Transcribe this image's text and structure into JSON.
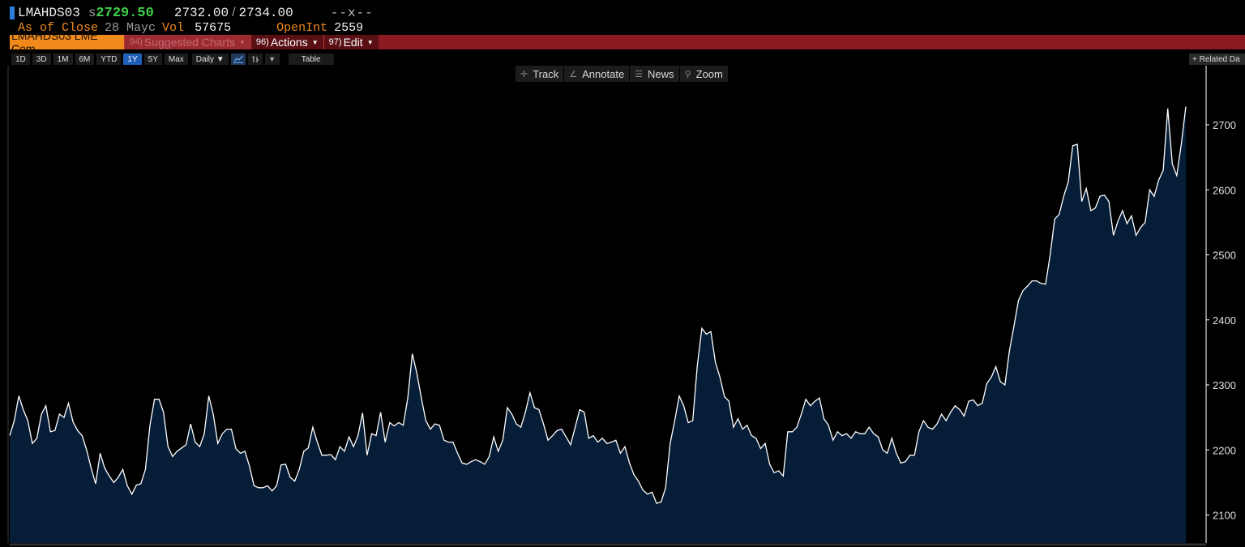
{
  "header": {
    "ticker": "LMAHDS03",
    "last_prefix": "s",
    "last_price": "2729.50",
    "bid": "2732.00",
    "slash": "/",
    "ask": "2734.00",
    "change": "--x--",
    "close_label": "As of Close",
    "close_date": "28 Mayc",
    "vol_label": "Vol",
    "vol_value": "57675",
    "openint_label": "OpenInt",
    "openint_value": "2559"
  },
  "menu": {
    "security": "LMAHDS03 LME Com",
    "suggested_num": "94)",
    "suggested": "Suggested Charts",
    "actions_num": "96)",
    "actions": "Actions",
    "edit_num": "97)",
    "edit": "Edit"
  },
  "ranges": [
    "1D",
    "3D",
    "1M",
    "6M",
    "YTD",
    "1Y",
    "5Y",
    "Max"
  ],
  "active_range": "1Y",
  "frequency": "Daily ▼",
  "table_label": "Table",
  "related_label": "+ Related Da",
  "chart_tools": {
    "track": "Track",
    "annotate": "Annotate",
    "news": "News",
    "zoom": "Zoom"
  },
  "colors": {
    "price_up": "#3fd04a",
    "accent_orange": "#f08a1c",
    "toolbar_red": "#8b1a22",
    "area_fill": "#061d38",
    "line": "#ffffff"
  },
  "chart_data": {
    "type": "area",
    "title": "",
    "xlabel": "",
    "ylabel": "",
    "ylim": [
      2050,
      2775
    ],
    "yticks": [
      2100,
      2200,
      2300,
      2400,
      2500,
      2600,
      2700
    ],
    "grid": false,
    "series": [
      {
        "values": [
          2222,
          2245,
          2283,
          2262,
          2245,
          2210,
          2218,
          2255,
          2268,
          2228,
          2230,
          2255,
          2250,
          2272,
          2243,
          2230,
          2222,
          2200,
          2172,
          2148,
          2195,
          2172,
          2160,
          2150,
          2158,
          2170,
          2145,
          2132,
          2146,
          2148,
          2170,
          2238,
          2278,
          2278,
          2258,
          2205,
          2190,
          2198,
          2203,
          2208,
          2240,
          2212,
          2205,
          2225,
          2283,
          2255,
          2210,
          2225,
          2232,
          2232,
          2202,
          2195,
          2198,
          2175,
          2145,
          2142,
          2142,
          2145,
          2137,
          2145,
          2177,
          2178,
          2158,
          2152,
          2170,
          2198,
          2203,
          2235,
          2212,
          2192,
          2192,
          2193,
          2185,
          2205,
          2198,
          2220,
          2205,
          2222,
          2257,
          2192,
          2225,
          2222,
          2258,
          2212,
          2242,
          2237,
          2242,
          2238,
          2280,
          2348,
          2318,
          2280,
          2245,
          2232,
          2240,
          2238,
          2215,
          2212,
          2212,
          2195,
          2180,
          2178,
          2182,
          2185,
          2182,
          2178,
          2190,
          2220,
          2198,
          2215,
          2265,
          2255,
          2240,
          2235,
          2258,
          2288,
          2265,
          2262,
          2240,
          2215,
          2222,
          2230,
          2232,
          2220,
          2208,
          2235,
          2262,
          2258,
          2218,
          2222,
          2212,
          2218,
          2210,
          2212,
          2215,
          2195,
          2205,
          2180,
          2162,
          2152,
          2138,
          2132,
          2135,
          2118,
          2120,
          2142,
          2210,
          2245,
          2283,
          2268,
          2242,
          2245,
          2330,
          2387,
          2378,
          2382,
          2335,
          2312,
          2282,
          2275,
          2235,
          2248,
          2232,
          2238,
          2222,
          2218,
          2202,
          2210,
          2178,
          2165,
          2168,
          2160,
          2228,
          2228,
          2235,
          2255,
          2278,
          2268,
          2275,
          2280,
          2248,
          2238,
          2215,
          2228,
          2222,
          2225,
          2218,
          2228,
          2225,
          2225,
          2235,
          2225,
          2220,
          2200,
          2195,
          2218,
          2195,
          2180,
          2182,
          2192,
          2192,
          2228,
          2245,
          2235,
          2232,
          2240,
          2255,
          2245,
          2258,
          2268,
          2262,
          2252,
          2275,
          2277,
          2268,
          2272,
          2302,
          2312,
          2328,
          2305,
          2300,
          2352,
          2390,
          2430,
          2445,
          2452,
          2460,
          2460,
          2456,
          2455,
          2500,
          2555,
          2562,
          2590,
          2612,
          2668,
          2670,
          2582,
          2602,
          2568,
          2572,
          2590,
          2592,
          2582,
          2530,
          2552,
          2568,
          2548,
          2560,
          2530,
          2542,
          2550,
          2600,
          2590,
          2615,
          2630,
          2725,
          2640,
          2622,
          2670,
          2728
        ]
      }
    ]
  }
}
